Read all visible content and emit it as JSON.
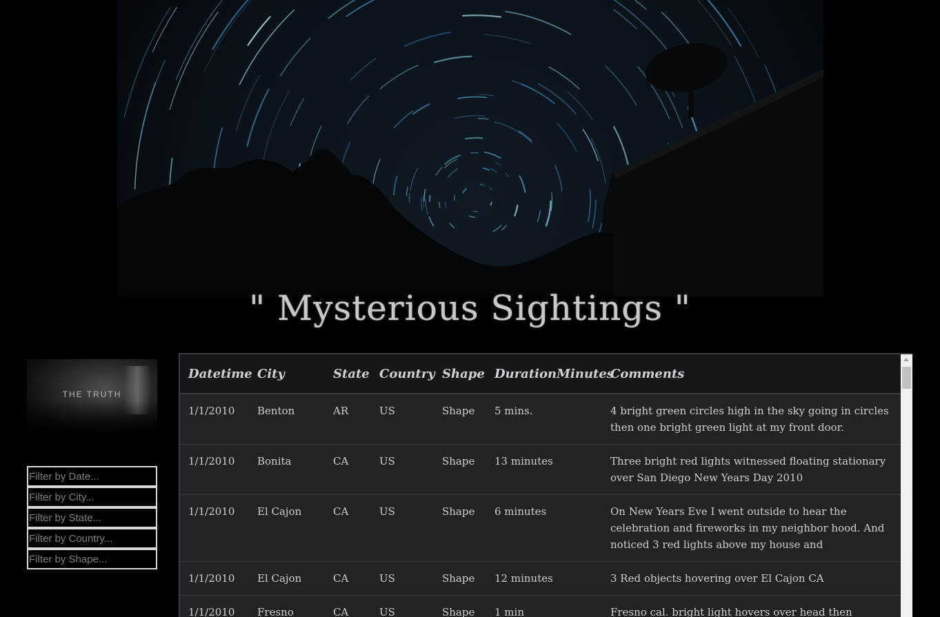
{
  "title": "\" Mysterious Sightings \"",
  "side_image": {
    "label": "THE TRUTH"
  },
  "filters": [
    {
      "placeholder": "Filter by Date..."
    },
    {
      "placeholder": "Filter by City..."
    },
    {
      "placeholder": "Filter by State..."
    },
    {
      "placeholder": "Filter by Country..."
    },
    {
      "placeholder": "Filter by Shape..."
    }
  ],
  "table": {
    "headers": [
      "Datetime",
      "City",
      "State",
      "Country",
      "Shape",
      "DurationMinutes",
      "Comments"
    ],
    "rows": [
      [
        "1/1/2010",
        "Benton",
        "AR",
        "US",
        "Shape",
        "5 mins.",
        "4 bright green circles high in the sky going in circles then one bright green light at my front door."
      ],
      [
        "1/1/2010",
        "Bonita",
        "CA",
        "US",
        "Shape",
        "13 minutes",
        "Three bright red lights witnessed floating stationary over San Diego New Years Day 2010"
      ],
      [
        "1/1/2010",
        "El Cajon",
        "CA",
        "US",
        "Shape",
        "6 minutes",
        "On New Years Eve I went outside to hear the celebration and fireworks in my neighbor hood. And noticed 3 red lights above my house and"
      ],
      [
        "1/1/2010",
        "El Cajon",
        "CA",
        "US",
        "Shape",
        "12 minutes",
        "3 Red objects hovering over El Cajon CA"
      ],
      [
        "1/1/2010",
        "Fresno",
        "CA",
        "US",
        "Shape",
        "1 min",
        "Fresno cal. bright light hovers over head then vanished"
      ]
    ]
  },
  "colors": {
    "background": "#000000",
    "table_bg": "#212326",
    "header_bg": "#15171a",
    "text": "#cfcfcf"
  }
}
